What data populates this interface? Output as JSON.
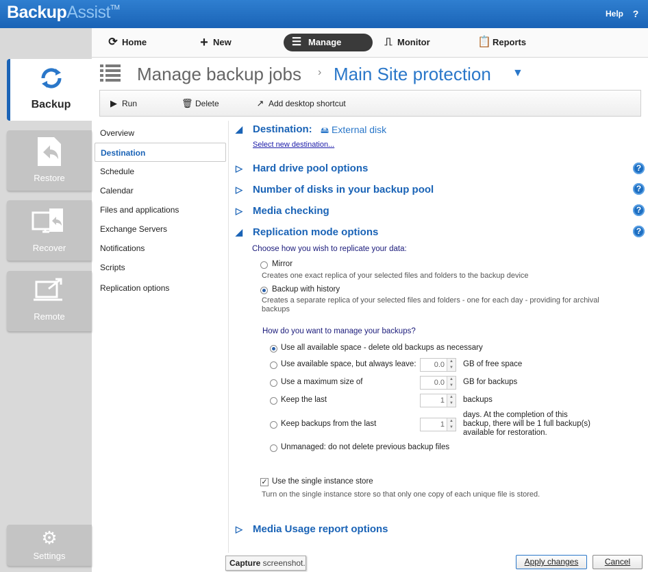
{
  "app": {
    "logo_bold": "Backup",
    "logo_light": "Assist",
    "logo_tm": "TM",
    "help_label": "Help",
    "help_icon": "?"
  },
  "topnav": [
    {
      "label": "Home",
      "icon": "home-icon"
    },
    {
      "label": "New",
      "icon": "plus-icon"
    },
    {
      "label": "Manage",
      "icon": "list-icon"
    },
    {
      "label": "Monitor",
      "icon": "monitor-icon"
    },
    {
      "label": "Reports",
      "icon": "clipboard-icon"
    }
  ],
  "sidebar": [
    {
      "label": "Backup",
      "icon": "backup-refresh-icon"
    },
    {
      "label": "Restore",
      "icon": "restore-arrow-icon"
    },
    {
      "label": "Recover",
      "icon": "recover-screen-icon"
    },
    {
      "label": "Remote",
      "icon": "remote-laptop-icon"
    },
    {
      "label": "Settings",
      "icon": "gear-icon"
    }
  ],
  "breadcrumb": {
    "section": "Manage backup jobs",
    "separator": "›",
    "job": "Main Site protection",
    "dropdown": "▼"
  },
  "toolbar": {
    "run": "Run",
    "delete": "Delete",
    "shortcut": "Add desktop shortcut"
  },
  "leftmenu": [
    "Overview",
    "Destination",
    "Schedule",
    "Calendar",
    "Files and applications",
    "Exchange Servers",
    "Notifications",
    "Scripts",
    "Replication options"
  ],
  "destination": {
    "label": "Destination:",
    "device": "External disk",
    "select_link": "Select new destination..."
  },
  "sections": {
    "hard_drive_pool": "Hard drive pool options",
    "num_disks": "Number of disks in your backup pool",
    "media_checking": "Media checking",
    "replication": "Replication mode options",
    "media_usage": "Media Usage report options"
  },
  "replication": {
    "prompt": "Choose how you wish to replicate your data:",
    "mirror_label": "Mirror",
    "mirror_desc": "Creates one exact replica of your selected files and folders to the backup device",
    "history_label": "Backup with history",
    "history_desc_1": "Creates a separate replica of your selected files and folders - one for each day - providing for archival",
    "history_desc_2": "backups",
    "manage_prompt": "How do you want to manage your backups?",
    "opt_all_space": "Use all available space - delete old backups as necessary",
    "opt_leave": "Use available space, but always leave:",
    "leave_value": "0.0",
    "leave_unit": "GB of free space",
    "opt_max": "Use a maximum size of",
    "max_value": "0.0",
    "max_unit": "GB for backups",
    "opt_keep_last": "Keep the last",
    "keep_value": "1",
    "keep_unit": "backups",
    "opt_keep_from": "Keep backups from the last",
    "keep_from_value": "1",
    "keep_from_unit_1": "days. At the completion of this",
    "keep_from_unit_2": "backup, there will be 1 full backup(s)",
    "keep_from_unit_3": "available for restoration.",
    "opt_unmanaged": "Unmanaged: do not delete previous backup files",
    "sis_label": "Use the single instance store",
    "sis_desc": "Turn on the single instance store so that only one copy of each unique file is stored."
  },
  "footer": {
    "apply": "Apply changes",
    "cancel": "Cancel",
    "tooltip_bold": "Capture",
    "tooltip_rest": " screenshot."
  }
}
